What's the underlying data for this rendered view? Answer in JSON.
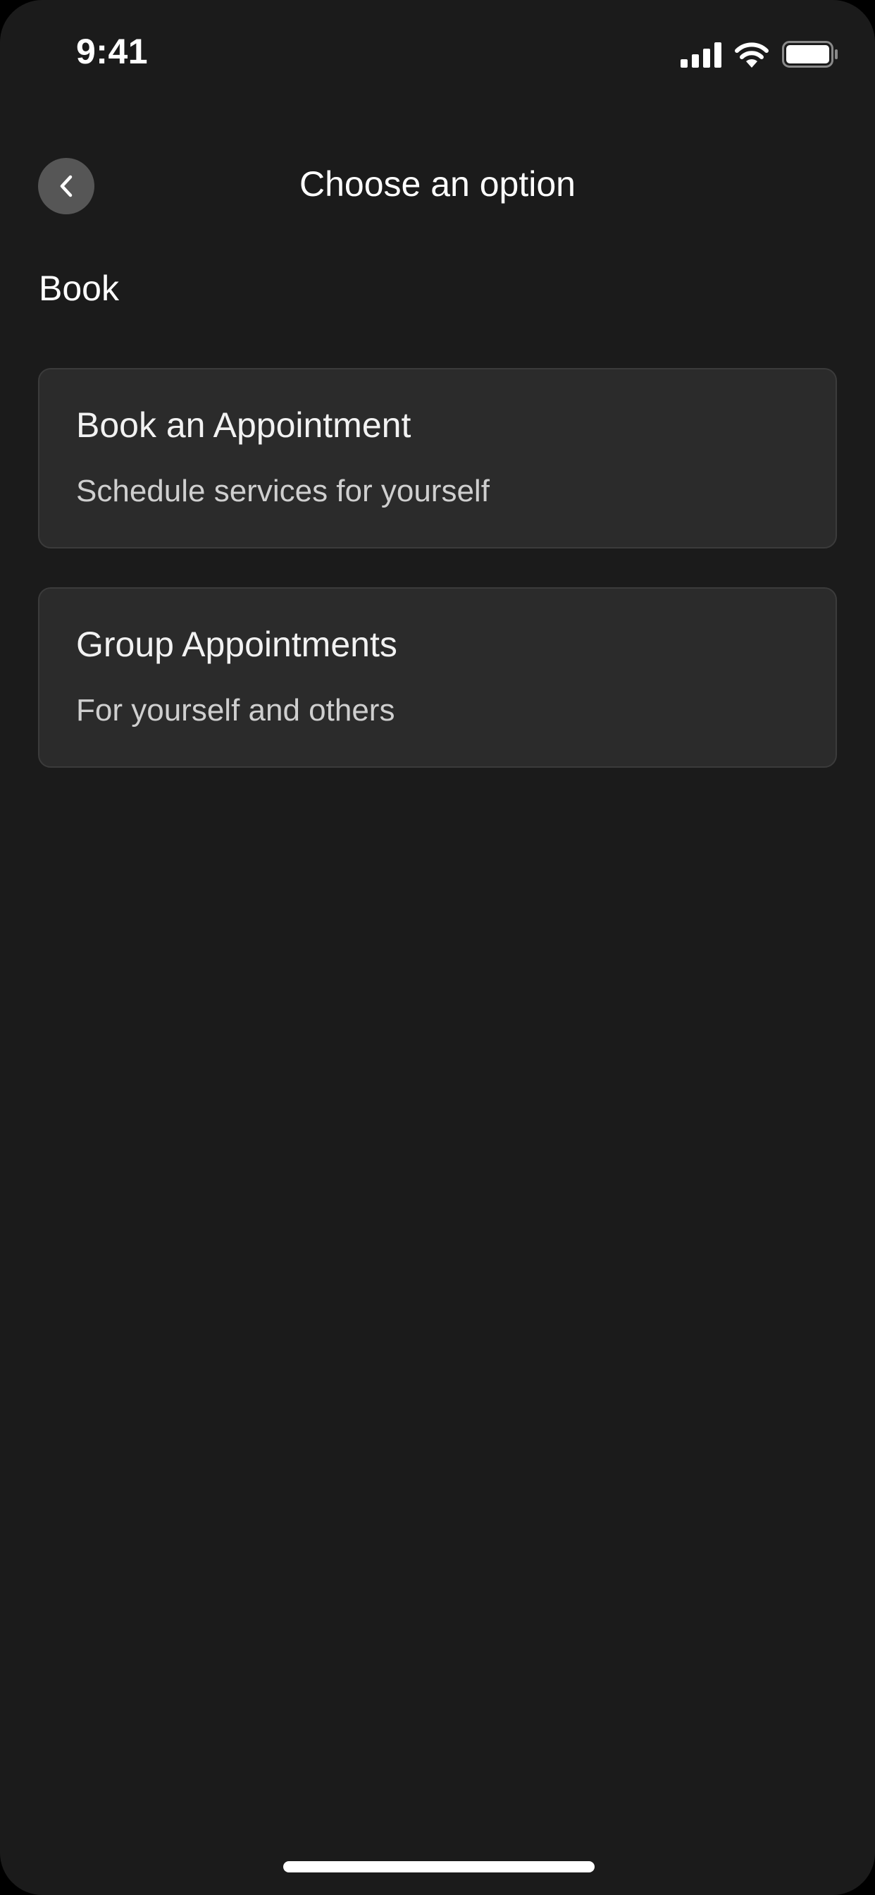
{
  "status_bar": {
    "time": "9:41",
    "icons": [
      "signal-icon",
      "wifi-icon",
      "battery-icon"
    ]
  },
  "header": {
    "title": "Choose an option",
    "back_icon": "chevron-left-icon"
  },
  "section": {
    "label": "Book"
  },
  "options": [
    {
      "title": "Book an Appointment",
      "subtitle": "Schedule services for yourself"
    },
    {
      "title": "Group Appointments",
      "subtitle": "For yourself and others"
    }
  ],
  "colors": {
    "background": "#1b1b1b",
    "card_background": "#2b2b2b",
    "card_border": "#3b3b3b",
    "back_button": "#565656",
    "text_primary": "#ffffff",
    "text_secondary": "#cfcfcf"
  }
}
